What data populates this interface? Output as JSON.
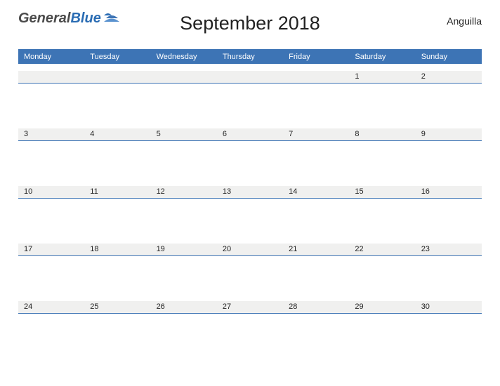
{
  "brand": {
    "part1": "General",
    "part2": "Blue"
  },
  "title": "September 2018",
  "region": "Anguilla",
  "day_names": [
    "Monday",
    "Tuesday",
    "Wednesday",
    "Thursday",
    "Friday",
    "Saturday",
    "Sunday"
  ],
  "weeks": [
    [
      "",
      "",
      "",
      "",
      "",
      "1",
      "2"
    ],
    [
      "3",
      "4",
      "5",
      "6",
      "7",
      "8",
      "9"
    ],
    [
      "10",
      "11",
      "12",
      "13",
      "14",
      "15",
      "16"
    ],
    [
      "17",
      "18",
      "19",
      "20",
      "21",
      "22",
      "23"
    ],
    [
      "24",
      "25",
      "26",
      "27",
      "28",
      "29",
      "30"
    ]
  ]
}
